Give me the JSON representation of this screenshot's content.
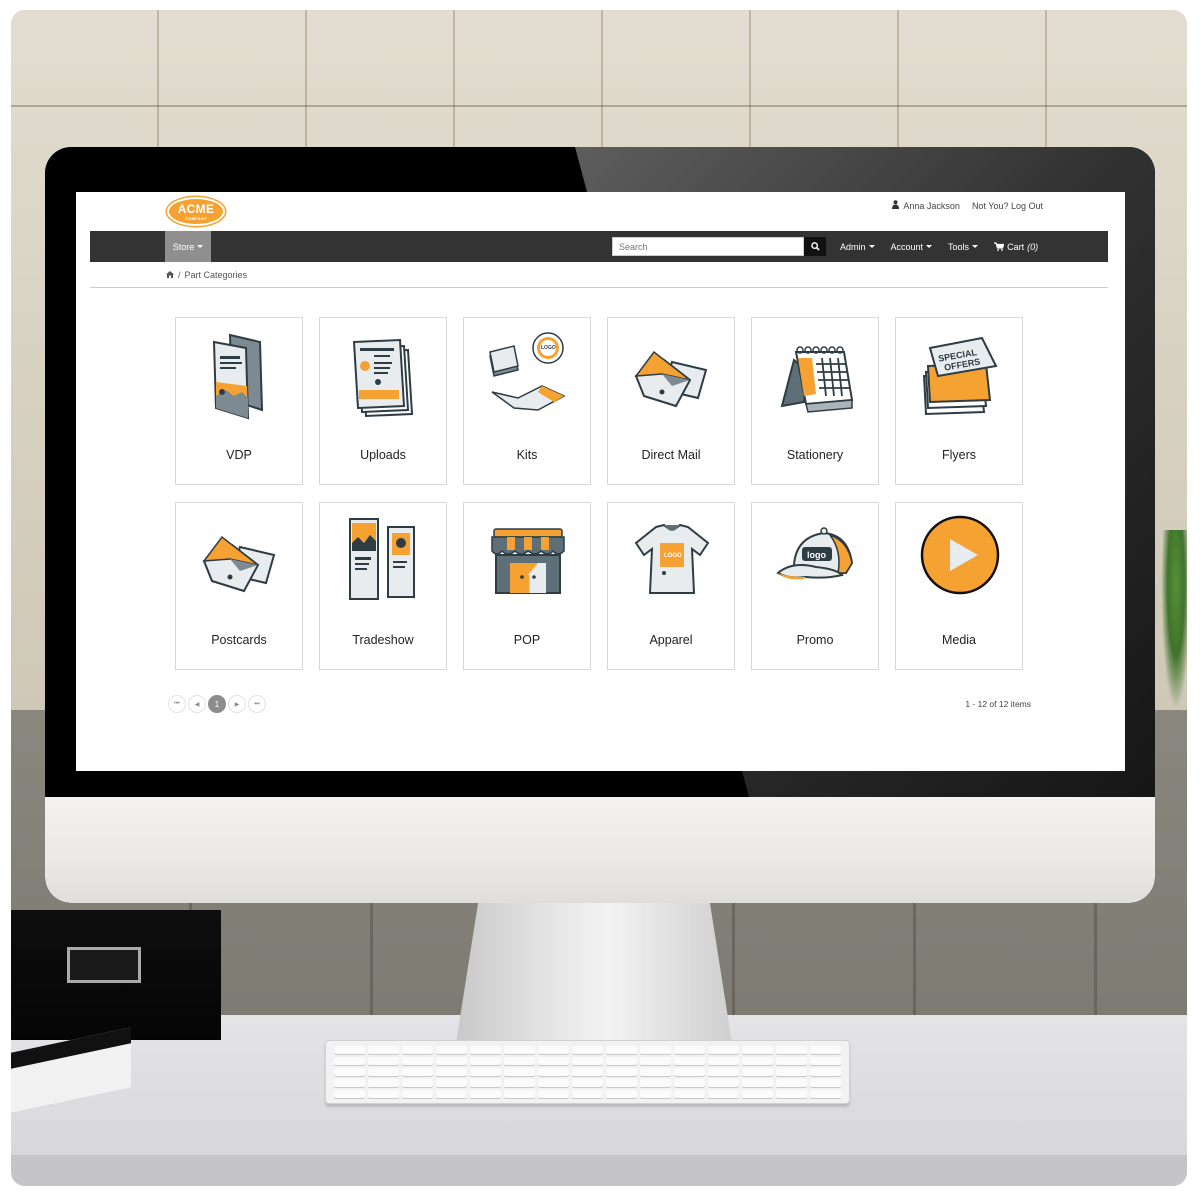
{
  "header": {
    "logo_text": "ACME",
    "logo_subtext": "COMPANY",
    "user_icon": "user-icon",
    "user_name": "Anna Jackson",
    "logout_link": "Not You? Log Out"
  },
  "nav": {
    "store_label": "Store",
    "search_placeholder": "Search",
    "search_icon": "search-icon",
    "links": [
      {
        "label": "Admin"
      },
      {
        "label": "Account"
      },
      {
        "label": "Tools"
      }
    ],
    "cart_icon": "cart-icon",
    "cart_label": "Cart",
    "cart_count": "(0)"
  },
  "breadcrumb": {
    "home_icon": "home-icon",
    "separator": "/",
    "current": "Part Categories"
  },
  "categories": [
    {
      "label": "VDP",
      "icon": "folded-brochure-icon"
    },
    {
      "label": "Uploads",
      "icon": "document-stack-icon"
    },
    {
      "label": "Kits",
      "icon": "kit-icon"
    },
    {
      "label": "Direct Mail",
      "icon": "envelope-icon"
    },
    {
      "label": "Stationery",
      "icon": "calendar-icon"
    },
    {
      "label": "Flyers",
      "icon": "special-offers-flyer-icon"
    },
    {
      "label": "Postcards",
      "icon": "envelope-icon"
    },
    {
      "label": "Tradeshow",
      "icon": "banner-stand-icon"
    },
    {
      "label": "POP",
      "icon": "storefront-icon"
    },
    {
      "label": "Apparel",
      "icon": "tshirt-icon"
    },
    {
      "label": "Promo",
      "icon": "cap-icon"
    },
    {
      "label": "Media",
      "icon": "play-button-icon"
    }
  ],
  "icon_text": {
    "kits_logo": "LOGO",
    "flyer_line1": "SPECIAL",
    "flyer_line2": "OFFERS",
    "tshirt_logo": "LOGO",
    "cap_logo": "logo"
  },
  "pagination": {
    "first": "⏮",
    "prev": "◀",
    "current_page": "1",
    "next": "▶",
    "last": "⏭",
    "summary": "1 - 12 of 12 items"
  },
  "colors": {
    "accent": "#f5a233",
    "navbar": "#333333",
    "active_nav": "#8f8f8f"
  }
}
